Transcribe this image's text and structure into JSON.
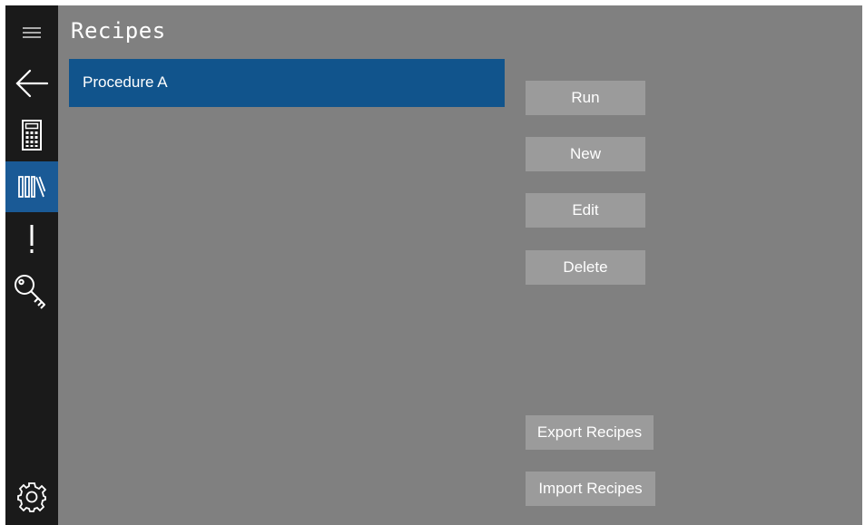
{
  "page": {
    "title": "Recipes"
  },
  "nav": {
    "items": [
      {
        "icon": "menu-icon"
      },
      {
        "icon": "back-arrow-icon"
      },
      {
        "icon": "calculator-icon"
      },
      {
        "icon": "library-icon",
        "selected": true
      },
      {
        "icon": "exclamation-icon"
      },
      {
        "icon": "key-icon"
      },
      {
        "icon": "gear-icon"
      }
    ]
  },
  "recipes": {
    "items": [
      {
        "label": "Procedure A",
        "selected": true
      }
    ]
  },
  "actions": {
    "run": "Run",
    "new": "New",
    "edit": "Edit",
    "delete": "Delete",
    "export": "Export Recipes",
    "import": "Import Recipes"
  },
  "colors": {
    "rail_background": "#1a1a1a",
    "selected_accent": "#11548c",
    "content_background": "#808080",
    "button_background": "#9b9b9b",
    "text": "#ffffff"
  }
}
